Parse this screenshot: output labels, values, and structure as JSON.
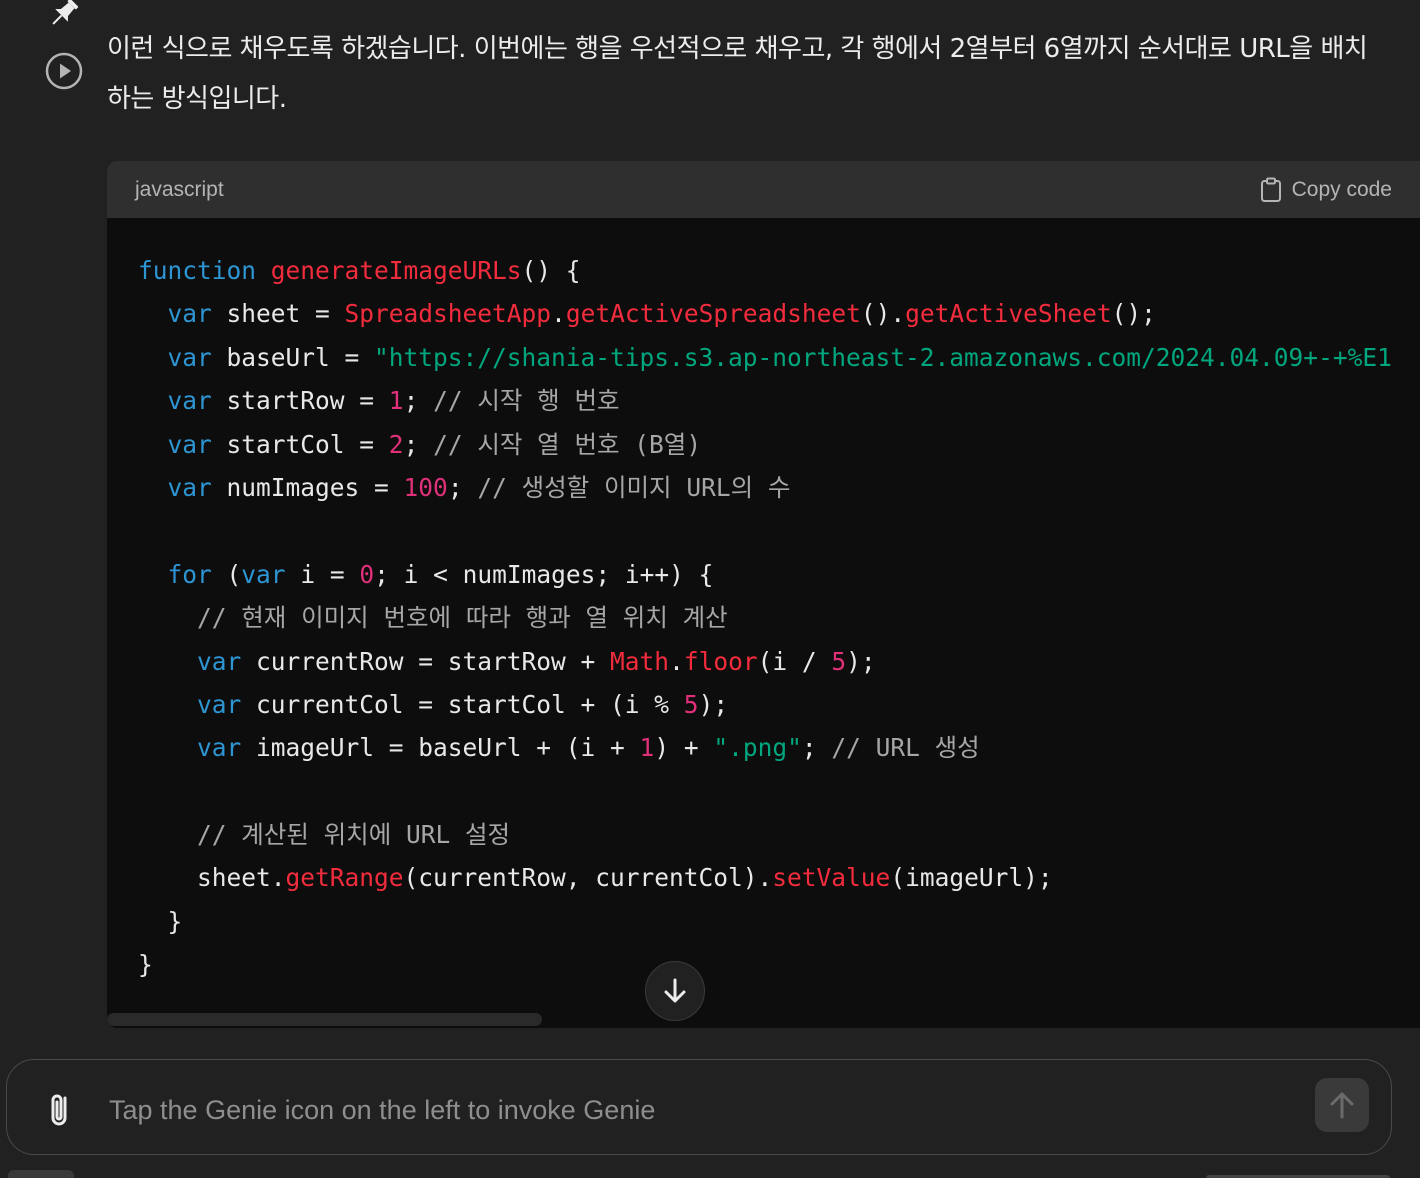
{
  "message": {
    "lines": [
      "이런 식으로 채우도록 하겠습니다. 이번에는 행을 우선적으로 채우고, 각 행에서 2열부터 6열까지 순서대로 URL을 배치",
      "하는 방식입니다."
    ]
  },
  "code_block": {
    "language": "javascript",
    "copy_label": "Copy code",
    "lines": [
      [
        {
          "t": "kw",
          "v": "function"
        },
        {
          "t": "p",
          "v": " "
        },
        {
          "t": "fn",
          "v": "generateImageURLs"
        },
        {
          "t": "p",
          "v": "() {"
        }
      ],
      [
        {
          "t": "p",
          "v": "  "
        },
        {
          "t": "kw",
          "v": "var"
        },
        {
          "t": "p",
          "v": " sheet = "
        },
        {
          "t": "fn",
          "v": "SpreadsheetApp"
        },
        {
          "t": "p",
          "v": "."
        },
        {
          "t": "fn",
          "v": "getActiveSpreadsheet"
        },
        {
          "t": "p",
          "v": "()."
        },
        {
          "t": "fn",
          "v": "getActiveSheet"
        },
        {
          "t": "p",
          "v": "();"
        }
      ],
      [
        {
          "t": "p",
          "v": "  "
        },
        {
          "t": "kw",
          "v": "var"
        },
        {
          "t": "p",
          "v": " baseUrl = "
        },
        {
          "t": "str",
          "v": "\"https://shania-tips.s3.ap-northeast-2.amazonaws.com/2024.04.09+-+%E1"
        }
      ],
      [
        {
          "t": "p",
          "v": "  "
        },
        {
          "t": "kw",
          "v": "var"
        },
        {
          "t": "p",
          "v": " startRow = "
        },
        {
          "t": "num",
          "v": "1"
        },
        {
          "t": "p",
          "v": "; "
        },
        {
          "t": "cm",
          "v": "// 시작 행 번호"
        }
      ],
      [
        {
          "t": "p",
          "v": "  "
        },
        {
          "t": "kw",
          "v": "var"
        },
        {
          "t": "p",
          "v": " startCol = "
        },
        {
          "t": "num",
          "v": "2"
        },
        {
          "t": "p",
          "v": "; "
        },
        {
          "t": "cm",
          "v": "// 시작 열 번호 (B열)"
        }
      ],
      [
        {
          "t": "p",
          "v": "  "
        },
        {
          "t": "kw",
          "v": "var"
        },
        {
          "t": "p",
          "v": " numImages = "
        },
        {
          "t": "num",
          "v": "100"
        },
        {
          "t": "p",
          "v": "; "
        },
        {
          "t": "cm",
          "v": "// 생성할 이미지 URL의 수"
        }
      ],
      [],
      [
        {
          "t": "p",
          "v": "  "
        },
        {
          "t": "kw",
          "v": "for"
        },
        {
          "t": "p",
          "v": " ("
        },
        {
          "t": "kw",
          "v": "var"
        },
        {
          "t": "p",
          "v": " i = "
        },
        {
          "t": "num",
          "v": "0"
        },
        {
          "t": "p",
          "v": "; i < numImages; i++) {"
        }
      ],
      [
        {
          "t": "p",
          "v": "    "
        },
        {
          "t": "cm",
          "v": "// 현재 이미지 번호에 따라 행과 열 위치 계산"
        }
      ],
      [
        {
          "t": "p",
          "v": "    "
        },
        {
          "t": "kw",
          "v": "var"
        },
        {
          "t": "p",
          "v": " currentRow = startRow + "
        },
        {
          "t": "fn",
          "v": "Math"
        },
        {
          "t": "p",
          "v": "."
        },
        {
          "t": "fn",
          "v": "floor"
        },
        {
          "t": "p",
          "v": "(i / "
        },
        {
          "t": "num",
          "v": "5"
        },
        {
          "t": "p",
          "v": ");"
        }
      ],
      [
        {
          "t": "p",
          "v": "    "
        },
        {
          "t": "kw",
          "v": "var"
        },
        {
          "t": "p",
          "v": " currentCol = startCol + (i % "
        },
        {
          "t": "num",
          "v": "5"
        },
        {
          "t": "p",
          "v": ");"
        }
      ],
      [
        {
          "t": "p",
          "v": "    "
        },
        {
          "t": "kw",
          "v": "var"
        },
        {
          "t": "p",
          "v": " imageUrl = baseUrl + (i + "
        },
        {
          "t": "num",
          "v": "1"
        },
        {
          "t": "p",
          "v": ") + "
        },
        {
          "t": "str",
          "v": "\".png\""
        },
        {
          "t": "p",
          "v": "; "
        },
        {
          "t": "cm",
          "v": "// URL 생성"
        }
      ],
      [],
      [
        {
          "t": "p",
          "v": "    "
        },
        {
          "t": "cm",
          "v": "// 계산된 위치에 URL 설정"
        }
      ],
      [
        {
          "t": "p",
          "v": "    sheet."
        },
        {
          "t": "fn",
          "v": "getRange"
        },
        {
          "t": "p",
          "v": "(currentRow, currentCol)."
        },
        {
          "t": "fn",
          "v": "setValue"
        },
        {
          "t": "p",
          "v": "(imageUrl);"
        }
      ],
      [
        {
          "t": "p",
          "v": "  }"
        }
      ],
      [
        {
          "t": "p",
          "v": "}"
        }
      ]
    ]
  },
  "composer": {
    "placeholder": "Tap the Genie icon on the left to invoke Genie"
  },
  "icons": {
    "pin": "pin-icon",
    "play": "play-icon",
    "copy": "clipboard-icon",
    "scroll_down": "arrow-down-icon",
    "attach": "paperclip-icon",
    "send": "arrow-up-icon"
  },
  "colors": {
    "background": "#212121",
    "code_background": "#0d0d0d",
    "keyword": "#2e95d3",
    "function": "#f22c3d",
    "string": "#00a67d",
    "number": "#df3079",
    "comment": "#a6a6a6"
  }
}
